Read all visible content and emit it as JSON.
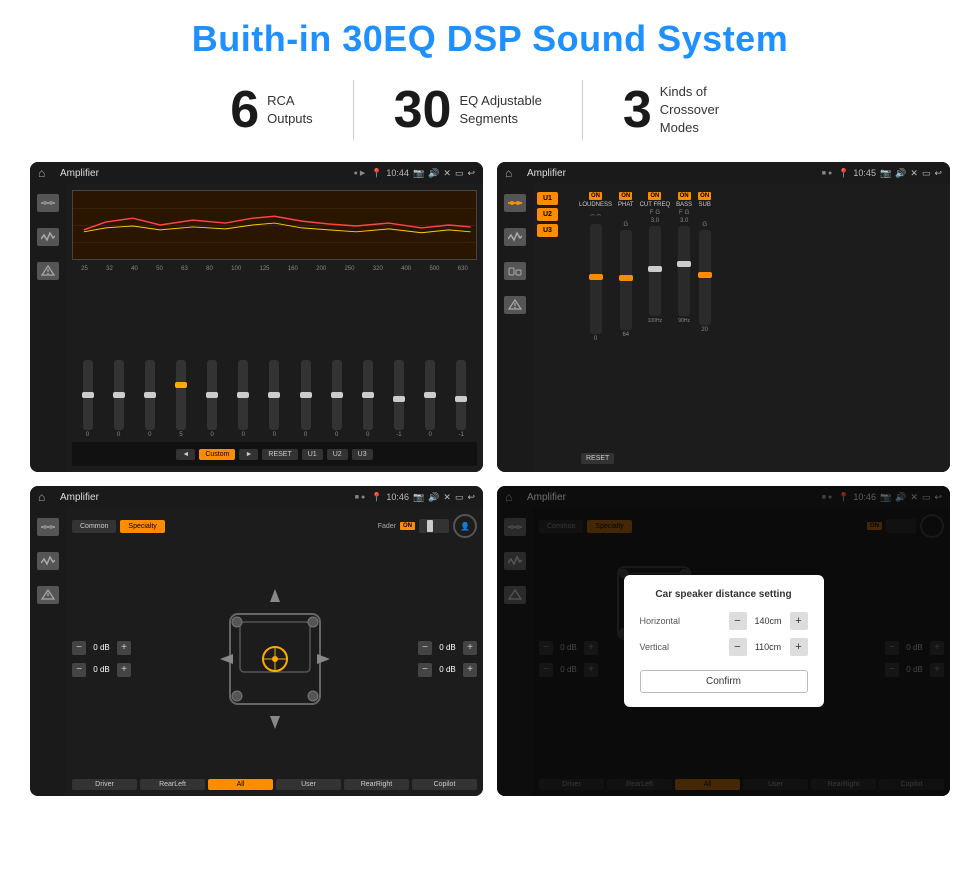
{
  "page": {
    "title": "Buith-in 30EQ DSP Sound System",
    "stats": [
      {
        "number": "6",
        "text_line1": "RCA",
        "text_line2": "Outputs"
      },
      {
        "number": "30",
        "text_line1": "EQ Adjustable",
        "text_line2": "Segments"
      },
      {
        "number": "3",
        "text_line1": "Kinds of",
        "text_line2": "Crossover Modes"
      }
    ]
  },
  "screens": {
    "eq_screen": {
      "header_title": "Amplifier",
      "time": "10:44",
      "freq_labels": [
        "25",
        "32",
        "40",
        "50",
        "63",
        "80",
        "100",
        "125",
        "160",
        "200",
        "250",
        "320",
        "400",
        "500",
        "630"
      ],
      "slider_values": [
        "0",
        "0",
        "0",
        "5",
        "0",
        "0",
        "0",
        "0",
        "0",
        "0",
        "-1",
        "0",
        "-1"
      ],
      "bottom_buttons": [
        "◄",
        "Custom",
        "►",
        "RESET",
        "U1",
        "U2",
        "U3"
      ]
    },
    "crossover_screen": {
      "header_title": "Amplifier",
      "time": "10:45",
      "presets": [
        "U1",
        "U2",
        "U3"
      ],
      "on_labels": [
        "ON",
        "ON",
        "ON",
        "ON",
        "ON"
      ],
      "channel_labels": [
        "LOUDNESS",
        "PHAT",
        "CUT FREQ",
        "BASS",
        "SUB"
      ],
      "reset_label": "RESET"
    },
    "specialty_screen": {
      "header_title": "Amplifier",
      "time": "10:46",
      "tabs": [
        "Common",
        "Specialty"
      ],
      "fader_label": "Fader",
      "on_label": "ON",
      "db_values_left": [
        "0 dB",
        "0 dB"
      ],
      "db_values_right": [
        "0 dB",
        "0 dB"
      ],
      "bottom_buttons": [
        "Driver",
        "RearLeft",
        "All",
        "User",
        "RearRight",
        "Copilot"
      ]
    },
    "distance_screen": {
      "header_title": "Amplifier",
      "time": "10:46",
      "tabs": [
        "Common",
        "Specialty"
      ],
      "on_label": "ON",
      "dialog": {
        "title": "Car speaker distance setting",
        "horizontal_label": "Horizontal",
        "horizontal_value": "140cm",
        "vertical_label": "Vertical",
        "vertical_value": "110cm",
        "confirm_label": "Confirm",
        "minus_symbol": "−",
        "plus_symbol": "+"
      },
      "bottom_buttons": [
        "Driver",
        "RearLeft",
        "All",
        "User",
        "RearRight",
        "Copilot"
      ],
      "db_values_right": [
        "0 dB",
        "0 dB"
      ]
    }
  }
}
